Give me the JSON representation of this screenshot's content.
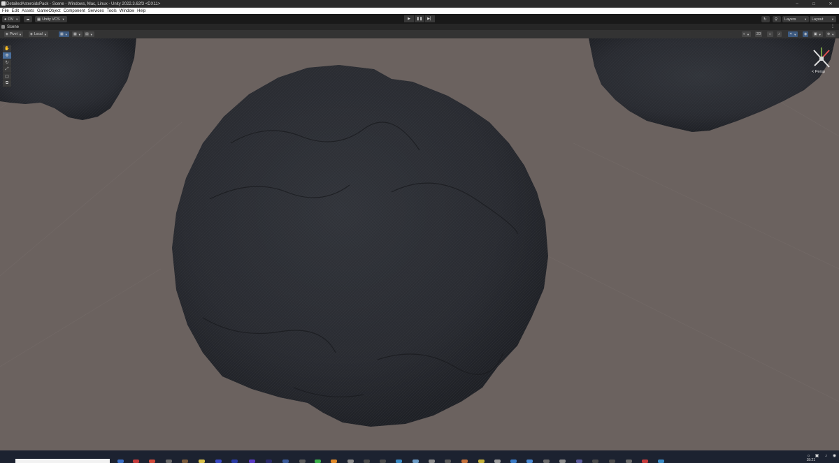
{
  "window": {
    "title": "DetailedAsteroidsPack - Scene - Windows, Mac, Linux - Unity 2022.3.62f3 <DX11>",
    "controls": [
      "–",
      "□",
      "✕"
    ]
  },
  "menu": [
    "File",
    "Edit",
    "Assets",
    "GameObject",
    "Component",
    "Services",
    "Tools",
    "Window",
    "Help"
  ],
  "toolbar": {
    "account": "OV",
    "vcs": "Unity VCS",
    "layers": "Layers",
    "layout": "Layout",
    "play": "▶",
    "pause": "❚❚",
    "step": "▶▏"
  },
  "tab": {
    "label": "Scene"
  },
  "scene_toolbar": {
    "pivot": "Pivot",
    "local": "Local",
    "view_2d": "2D"
  },
  "tools": [
    "✋",
    "✥",
    "↻",
    "⤢",
    "▢",
    "⧉"
  ],
  "gizmo": {
    "label": "< Persp"
  },
  "colors": {
    "viewport": "#6b625f",
    "asteroid": "#2a2c32",
    "accent": "#4a6f9c"
  },
  "taskbar": {
    "clock": "18:21"
  }
}
